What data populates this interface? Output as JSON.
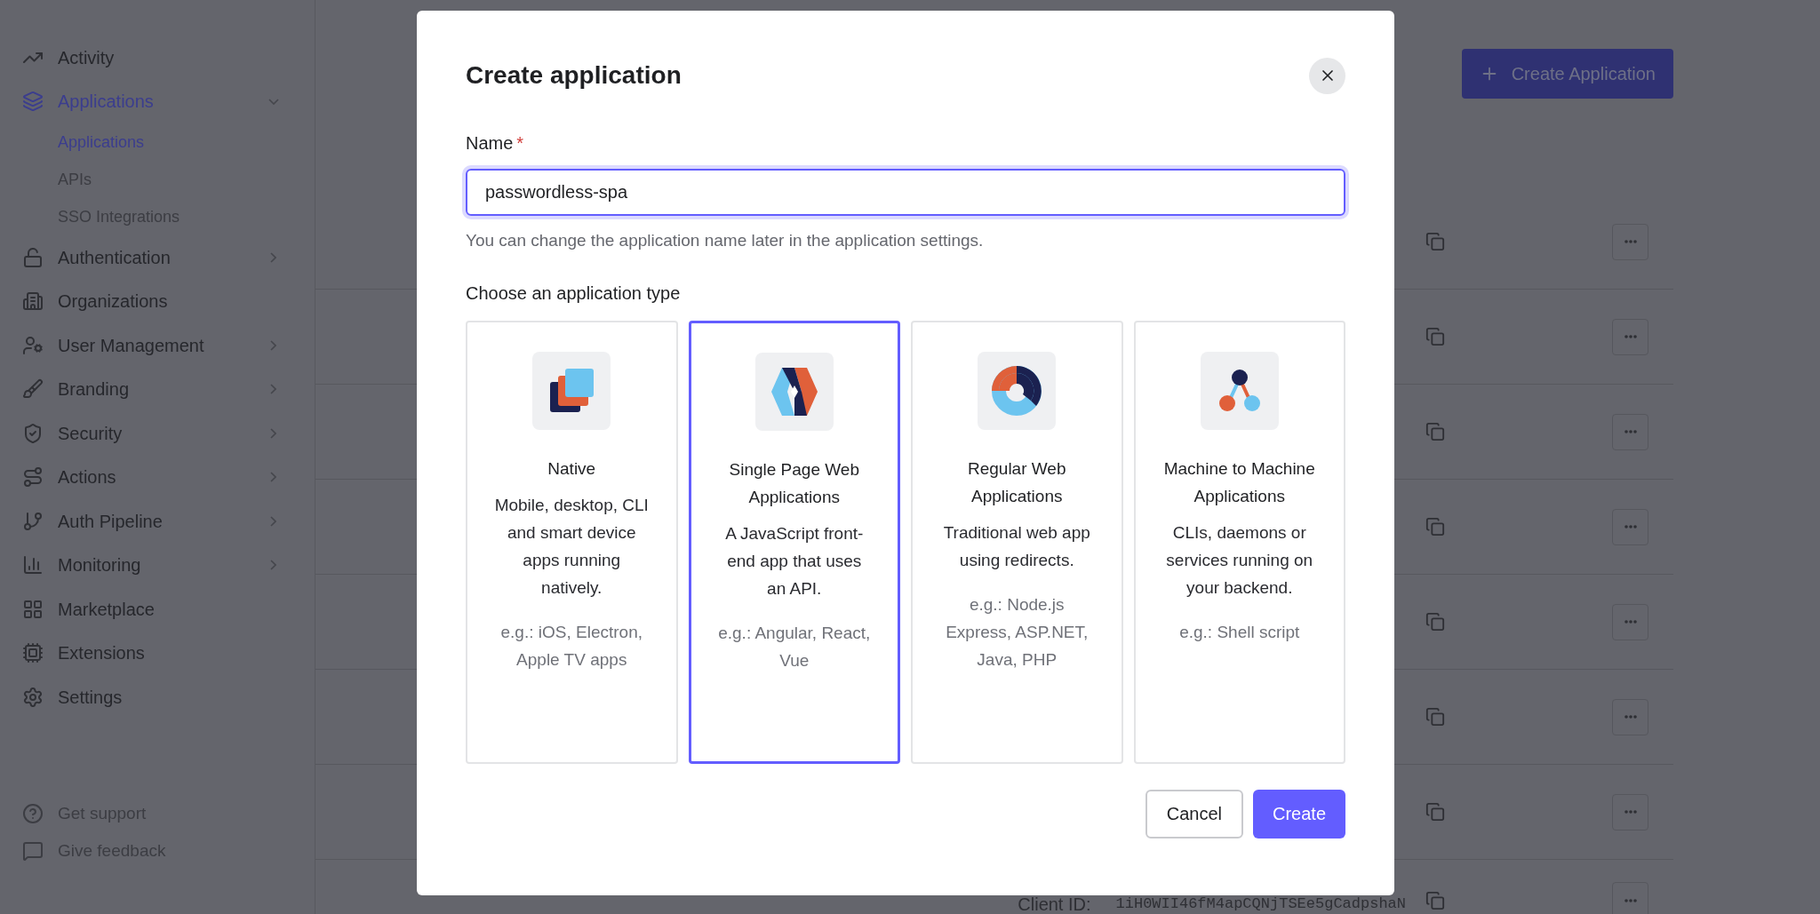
{
  "sidebar": {
    "items": [
      {
        "label": "Activity",
        "kind": "link",
        "selected": false
      },
      {
        "label": "Applications",
        "kind": "group",
        "selected": true,
        "expanded": true,
        "children": [
          {
            "label": "Applications",
            "selected": true
          },
          {
            "label": "APIs",
            "selected": false
          },
          {
            "label": "SSO Integrations",
            "selected": false
          }
        ]
      },
      {
        "label": "Authentication",
        "kind": "group",
        "selected": false,
        "expanded": false
      },
      {
        "label": "Organizations",
        "kind": "link",
        "selected": false
      },
      {
        "label": "User Management",
        "kind": "group",
        "selected": false,
        "expanded": false
      },
      {
        "label": "Branding",
        "kind": "group",
        "selected": false,
        "expanded": false
      },
      {
        "label": "Security",
        "kind": "group",
        "selected": false,
        "expanded": false
      },
      {
        "label": "Actions",
        "kind": "group",
        "selected": false,
        "expanded": false
      },
      {
        "label": "Auth Pipeline",
        "kind": "group",
        "selected": false,
        "expanded": false
      },
      {
        "label": "Monitoring",
        "kind": "group",
        "selected": false,
        "expanded": false
      },
      {
        "label": "Marketplace",
        "kind": "link",
        "selected": false
      },
      {
        "label": "Extensions",
        "kind": "link",
        "selected": false
      },
      {
        "label": "Settings",
        "kind": "link",
        "selected": false
      }
    ],
    "footer": [
      "Get support",
      "Give feedback"
    ]
  },
  "header": {
    "create_button": "Create Application"
  },
  "rows": [
    {
      "kind": "actions"
    },
    {
      "kind": "actions"
    },
    {
      "kind": "actions"
    },
    {
      "kind": "actions"
    },
    {
      "kind": "actions"
    },
    {
      "kind": "actions"
    },
    {
      "kind": "actions"
    },
    {
      "kind": "client",
      "client_label": "Client ID:",
      "client_id": "1iH0WII46fM4apCQNjTSEe5gCadpshaN"
    }
  ],
  "dialog": {
    "title": "Create application",
    "name_field": {
      "label": "Name",
      "required": true,
      "required_mark": "*",
      "value": "passwordless-spa",
      "focused": true
    },
    "hint": "You can change the application name later in the application settings.",
    "type_heading": "Choose an application type",
    "types": [
      {
        "kind": "native",
        "title": "Native",
        "description": "Mobile, desktop, CLI and smart device apps running natively.",
        "examples": "e.g.: iOS, Electron, Apple TV apps",
        "selected": false
      },
      {
        "kind": "spa",
        "title": "Single Page Web Applications",
        "description": "A JavaScript front-end app that uses an API.",
        "examples": "e.g.: Angular, React, Vue",
        "selected": true
      },
      {
        "kind": "regular",
        "title": "Regular Web Applications",
        "description": "Traditional web app using redirects.",
        "examples": "e.g.: Node.js Express, ASP.NET, Java, PHP",
        "selected": false
      },
      {
        "kind": "m2m",
        "title": "Machine to Machine Applications",
        "description": "CLIs, daemons or services running on your backend.",
        "examples": "e.g.: Shell script",
        "selected": false
      }
    ],
    "cancel_button": "Cancel",
    "create_button": "Create"
  }
}
